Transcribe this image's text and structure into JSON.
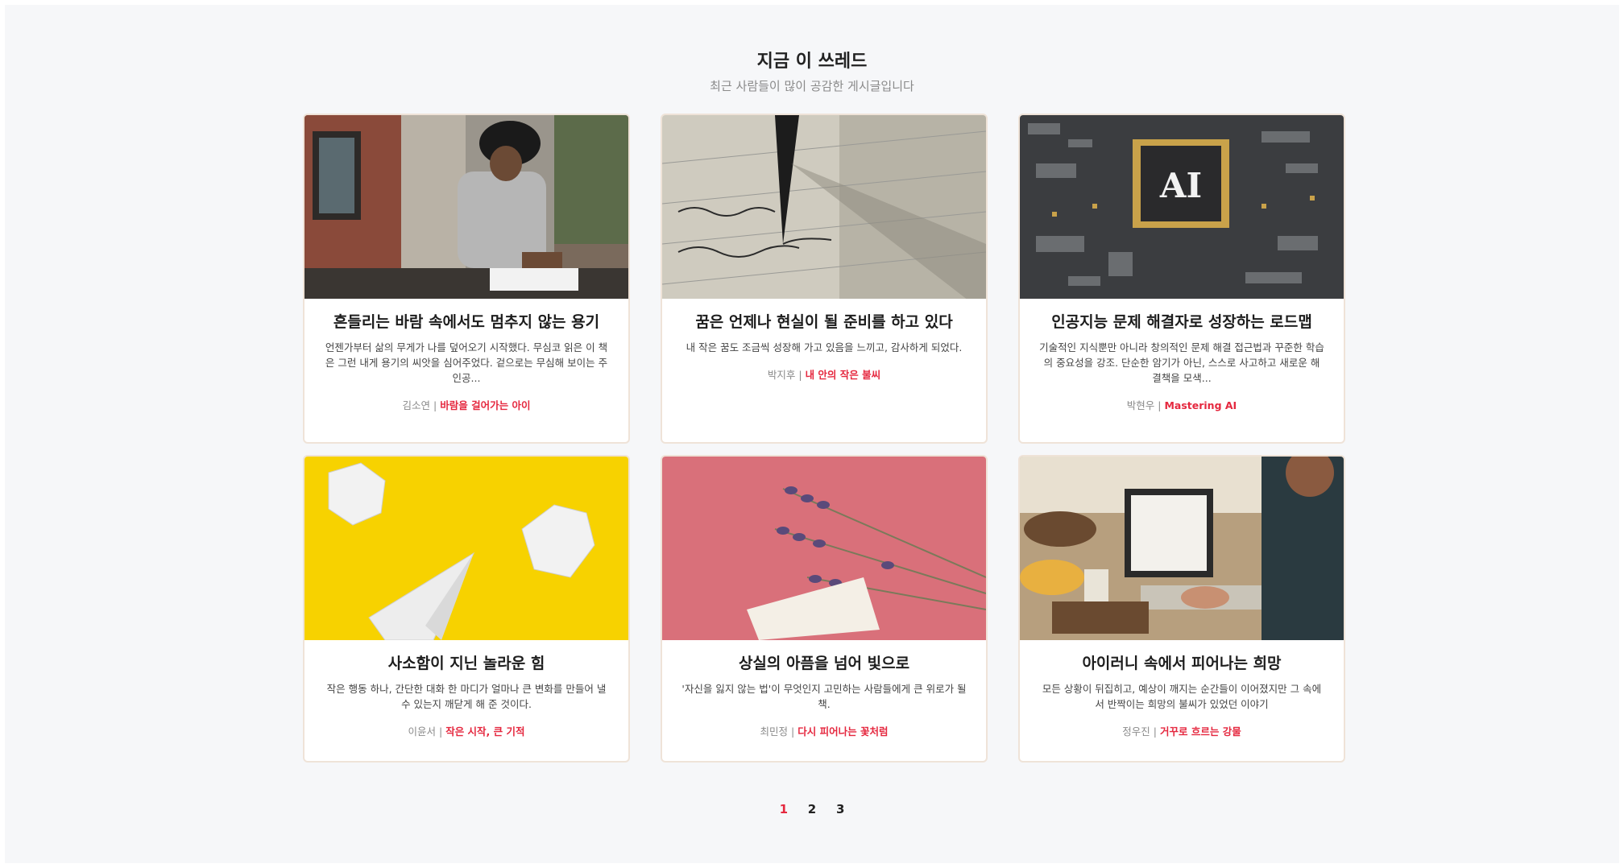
{
  "section": {
    "title": "지금 이 쓰레드",
    "subtitle": "최근 사람들이 많이 공감한 게시글입니다"
  },
  "cards": [
    {
      "title": "흔들리는 바람 속에서도 멈추지 않는 용기",
      "description": "언젠가부터 삶의 무게가 나를 덮어오기 시작했다. 무심코 읽은 이 책은 그런 내게 용기의 씨앗을 심어주었다. 겉으로는 무심해 보이는 주인공...",
      "author": "김소연",
      "separator": "|",
      "book": "바람을 걸어가는 아이",
      "image": "man-writing-photo"
    },
    {
      "title": "꿈은 언제나 현실이 될 준비를 하고 있다",
      "description": "내 작은 꿈도 조금씩 성장해 가고 있음을 느끼고, 감사하게 되었다.",
      "author": "박지후",
      "separator": "|",
      "book": "내 안의 작은 불씨",
      "image": "fountain-pen-photo"
    },
    {
      "title": "인공지능 문제 해결자로 성장하는 로드맵",
      "description": "기술적인 지식뿐만 아니라 창의적인 문제 해결 접근법과 꾸준한 학습의 중요성을 강조. 단순한 암기가 아닌, 스스로 사고하고 새로운 해결책을 모색...",
      "author": "박현우",
      "separator": "|",
      "book": "Mastering AI",
      "image": "ai-chip-photo"
    },
    {
      "title": "사소함이 지닌 놀라운 힘",
      "description": "작은 행동 하나, 간단한 대화 한 마디가 얼마나 큰 변화를 만들어 낼 수 있는지 깨닫게 해 준 것이다.",
      "author": "이윤서",
      "separator": "|",
      "book": "작은 시작, 큰 기적",
      "image": "crumpled-paper-photo"
    },
    {
      "title": "상실의 아픔을 넘어 빛으로",
      "description": "'자신을 잃지 않는 법'이 무엇인지 고민하는 사람들에게 큰 위로가 될 책.",
      "author": "최민정",
      "separator": "|",
      "book": "다시 피어나는 꽃처럼",
      "image": "lavender-photo"
    },
    {
      "title": "아이러니 속에서 피어나는 희망",
      "description": "모든 상황이 뒤집히고, 예상이 깨지는 순간들이 이어졌지만 그 속에서 반짝이는 희망의 불씨가 있었던 이야기",
      "author": "정우진",
      "separator": "|",
      "book": "거꾸로 흐르는 강물",
      "image": "laptop-desk-photo"
    }
  ],
  "pagination": {
    "pages": [
      "1",
      "2",
      "3"
    ],
    "active": "1"
  },
  "colors": {
    "accent": "#e5283f",
    "background": "#f6f7f9",
    "card_border": "#efe3d8"
  }
}
